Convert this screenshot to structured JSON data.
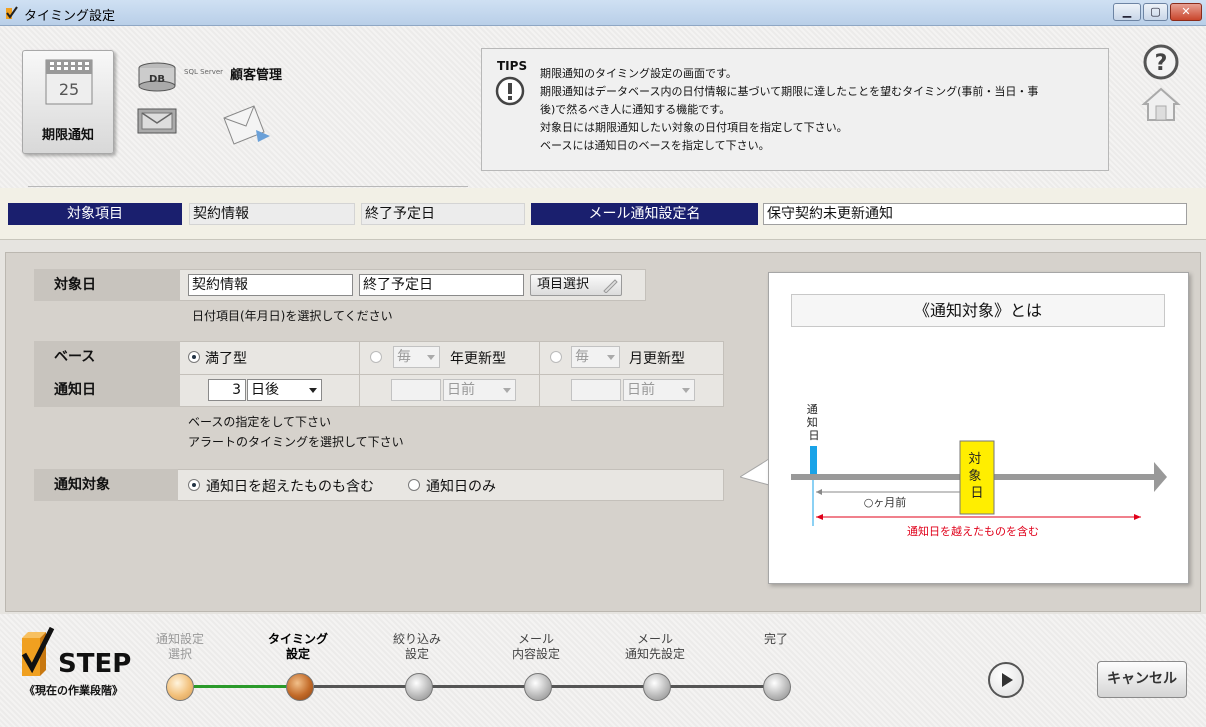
{
  "window": {
    "title": "タイミング設定"
  },
  "header": {
    "tile_label": "期限通知",
    "calendar_day": "25",
    "db_label": "DB",
    "sql_label": "SQL Server",
    "app_name": "顧客管理"
  },
  "tips": {
    "label": "TIPS",
    "lines": [
      "期限通知のタイミング設定の画面です。",
      "期限通知はデータベース内の日付情報に基づいて期限に達したことを望むタイミング(事前・当日・事",
      "後)で然るべき人に通知する機能です。",
      "対象日には期限通知したい対象の日付項目を指定して下さい。",
      "ベースには通知日のベースを指定して下さい。"
    ]
  },
  "target": {
    "label": "対象項目",
    "table": "契約情報",
    "field": "終了予定日",
    "mail_label": "メール通知設定名",
    "mail_name": "保守契約未更新通知"
  },
  "form": {
    "target_date_label": "対象日",
    "target_table": "契約情報",
    "target_field": "終了予定日",
    "select_button": "項目選択",
    "date_hint": "日付項目(年月日)を選択してください",
    "base_label": "ベース",
    "base_option1": "満了型",
    "base_option2_select": "毎",
    "base_option2": "年更新型",
    "base_option3_select": "毎",
    "base_option3": "月更新型",
    "notify_label": "通知日",
    "notify_days": "3",
    "notify_unit": "日後",
    "notify_unit2": "日前",
    "notify_unit3": "日前",
    "base_hint1": "ベースの指定をして下さい",
    "base_hint2": "アラートのタイミングを選択して下さい",
    "scope_label": "通知対象",
    "scope_option1": "通知日を超えたものも含む",
    "scope_option2": "通知日のみ"
  },
  "diagram": {
    "title": "《通知対象》とは",
    "notify_day": "通知日",
    "target_day": "対象日",
    "months_before": "○ヶ月前",
    "range_caption": "通知日を越えたものを含む",
    "colors": {
      "notify": "#1aa3e8",
      "target": "#ffee00",
      "range": "#e0001a",
      "arrow": "#999999"
    }
  },
  "steps": {
    "logo": "STEP",
    "caption": "《現在の作業段階》",
    "items": [
      {
        "line1": "通知設定",
        "line2": "選択",
        "state": "done"
      },
      {
        "line1": "タイミング",
        "line2": "設定",
        "state": "current"
      },
      {
        "line1": "絞り込み",
        "line2": "設定",
        "state": "todo"
      },
      {
        "line1": "メール",
        "line2": "内容設定",
        "state": "todo"
      },
      {
        "line1": "メール",
        "line2": "通知先設定",
        "state": "todo"
      },
      {
        "line1": "",
        "line2": "完了",
        "state": "todo"
      }
    ],
    "cancel": "キャンセル"
  }
}
